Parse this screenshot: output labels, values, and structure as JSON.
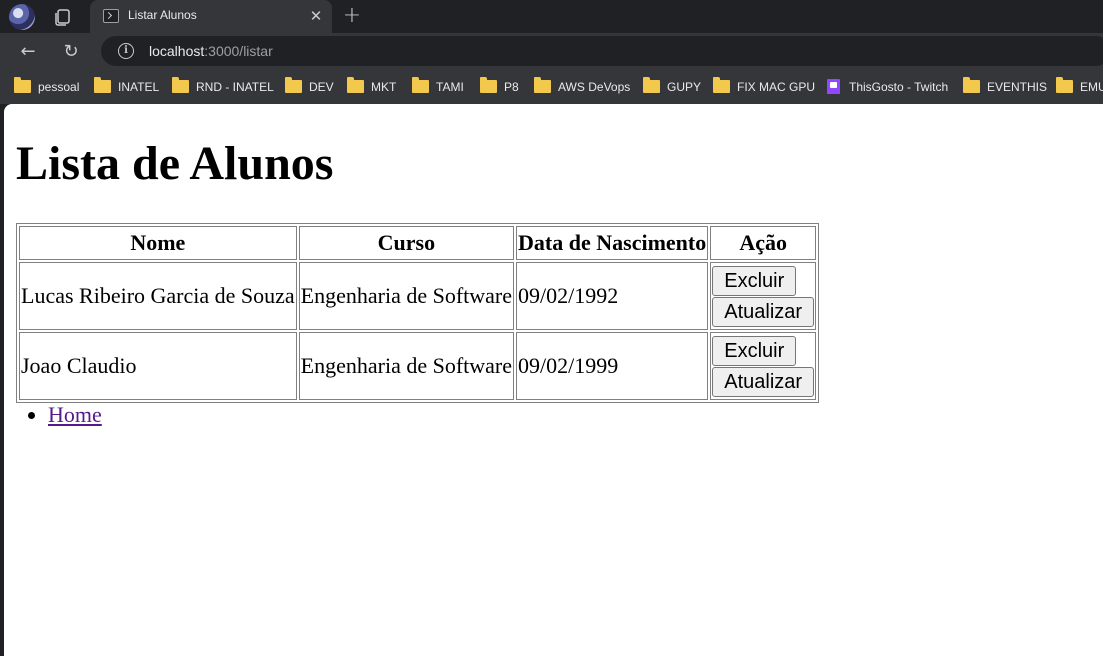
{
  "browser": {
    "tab": {
      "title": "Listar Alunos"
    },
    "url": {
      "host": "localhost",
      "path": ":3000/listar"
    },
    "bookmarks": [
      {
        "label": "pessoal",
        "icon": "folder-icon"
      },
      {
        "label": "INATEL",
        "icon": "folder-icon"
      },
      {
        "label": "RND - INATEL",
        "icon": "folder-icon"
      },
      {
        "label": "DEV",
        "icon": "folder-icon"
      },
      {
        "label": "MKT",
        "icon": "folder-icon"
      },
      {
        "label": "TAMI",
        "icon": "folder-icon"
      },
      {
        "label": "P8",
        "icon": "folder-icon"
      },
      {
        "label": "AWS DeVops",
        "icon": "folder-icon"
      },
      {
        "label": "GUPY",
        "icon": "folder-icon"
      },
      {
        "label": "FIX MAC GPU",
        "icon": "folder-icon"
      },
      {
        "label": "ThisGosto - Twitch",
        "icon": "twitch-icon"
      },
      {
        "label": "EVENTHIS",
        "icon": "folder-icon"
      },
      {
        "label": "EMU",
        "icon": "folder-icon"
      }
    ]
  },
  "page": {
    "title": "Lista de Alunos",
    "table": {
      "headers": [
        "Nome",
        "Curso",
        "Data de Nascimento",
        "Ação"
      ],
      "rows": [
        {
          "nome": "Lucas Ribeiro Garcia de Souza",
          "curso": "Engenharia de Software",
          "nascimento": "09/02/1992",
          "excluir": "Excluir",
          "atualizar": "Atualizar"
        },
        {
          "nome": "Joao Claudio",
          "curso": "Engenharia de Software",
          "nascimento": "09/02/1999",
          "excluir": "Excluir",
          "atualizar": "Atualizar"
        }
      ]
    },
    "nav": {
      "home": "Home"
    }
  }
}
